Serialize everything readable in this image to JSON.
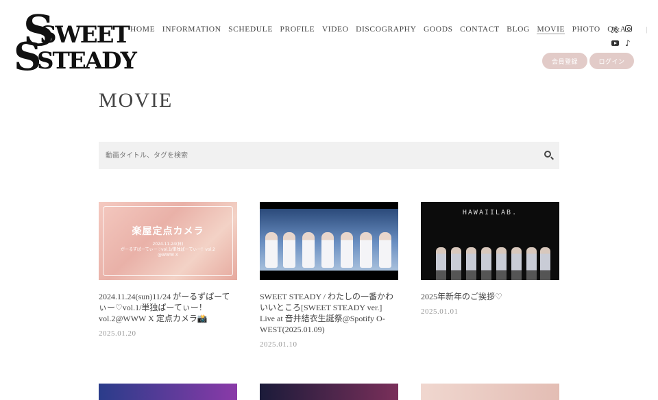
{
  "logo": {
    "line1": "SWEET",
    "line2": "STEADY"
  },
  "nav": [
    "HOME",
    "INFORMATION",
    "SCHEDULE",
    "PROFILE",
    "VIDEO",
    "DISCOGRAPHY",
    "GOODS",
    "CONTACT",
    "BLOG",
    "MOVIE",
    "PHOTO",
    "Q&A"
  ],
  "nav_separator": "|",
  "social": {
    "x": "𝕏",
    "tiktok": "♪"
  },
  "auth": {
    "register": "会員登録",
    "login": "ログイン"
  },
  "page_title": "MOVIE",
  "search": {
    "placeholder": "動画タイトル、タグを検索"
  },
  "videos": [
    {
      "title": "2024.11.24(sun)11/24 がーるずぱーてぃー♡vol.1/単独ぱーてぃー！vol.2@WWW X 定点カメラ📸",
      "date": "2025.01.20",
      "thumb_text": "楽屋定点カメラ",
      "thumb_sub1": "2024.11.24(日)",
      "thumb_sub2": "がーるずぱーてぃー♡vol.1/単独ぱーてぃー！vol.2",
      "thumb_sub3": "@WWW X"
    },
    {
      "title": "SWEET STEADY / わたしの一番かわいいところ[SWEET STEADY ver.] Live at 音井結衣生誕祭@Spotify O-WEST(2025.01.09)",
      "date": "2025.01.10"
    },
    {
      "title": "2025年新年のご挨拶♡",
      "date": "2025.01.01",
      "thumb_text": "HAWAIILAB."
    }
  ]
}
